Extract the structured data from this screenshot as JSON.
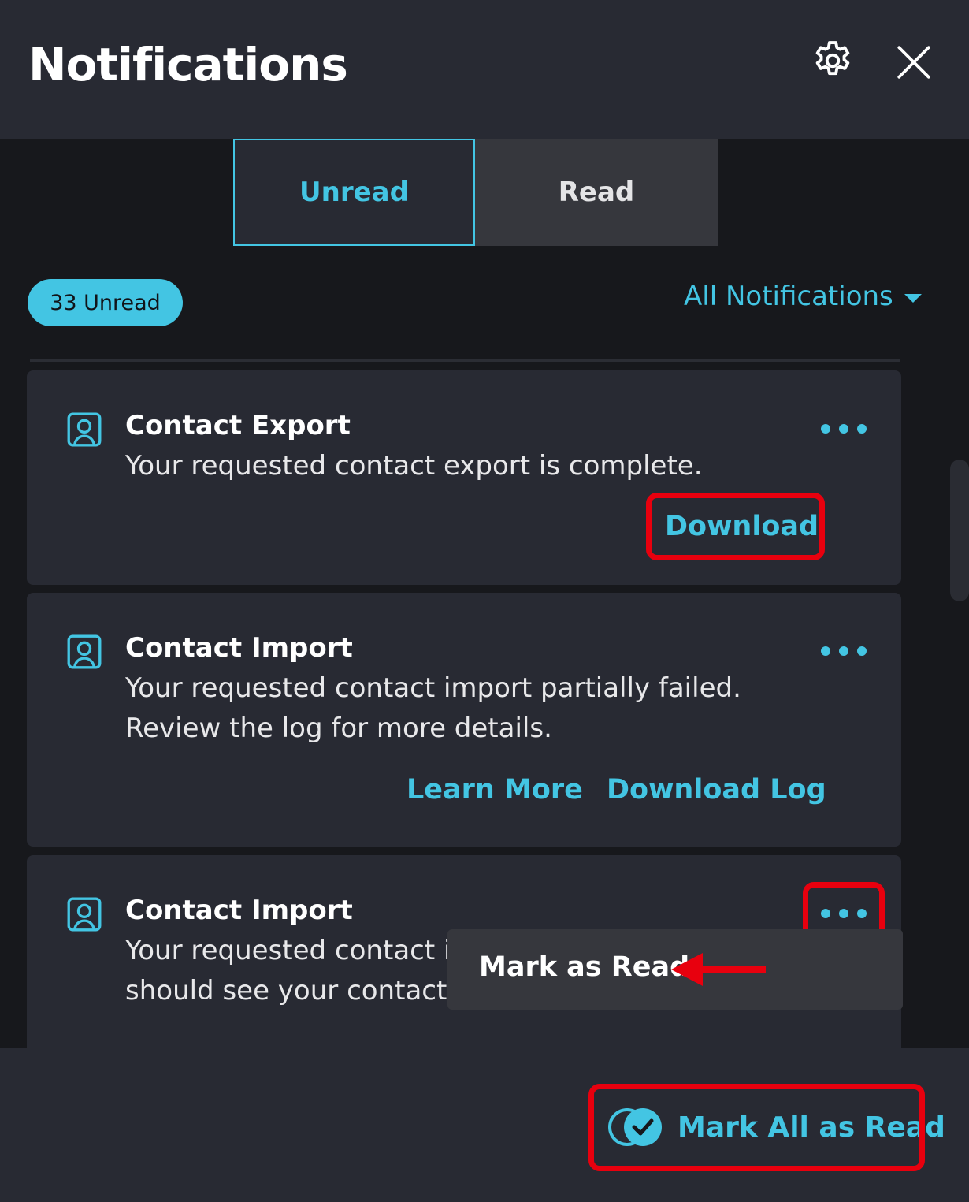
{
  "header": {
    "title": "Notifications",
    "icons": [
      "gear-icon",
      "close-icon"
    ]
  },
  "tabs": [
    {
      "label": "Unread",
      "active": true
    },
    {
      "label": "Read",
      "active": false
    }
  ],
  "summary": {
    "unread_badge": "33 Unread",
    "filter_label": "All Notifications"
  },
  "notifications": [
    {
      "icon": "contact-icon",
      "title": "Contact Export",
      "body_lines": [
        "Your requested contact export is complete."
      ],
      "actions": [
        "Download"
      ]
    },
    {
      "icon": "contact-icon",
      "title": "Contact Import",
      "body_lines": [
        "Your requested contact import partially failed.",
        "Review the log for more details."
      ],
      "actions": [
        "Learn More",
        "Download Log"
      ]
    },
    {
      "icon": "contact-icon",
      "title": "Contact Import",
      "body_lines": [
        "Your requested contact ir",
        "should see your contacts"
      ],
      "actions": []
    }
  ],
  "context_menu": {
    "items": [
      "Mark as Read"
    ]
  },
  "footer": {
    "mark_all_label": "Mark All as Read"
  },
  "colors": {
    "accent": "#43c5e3",
    "annotation": "#e8000e",
    "panel": "#282a33",
    "background": "#17181c"
  }
}
